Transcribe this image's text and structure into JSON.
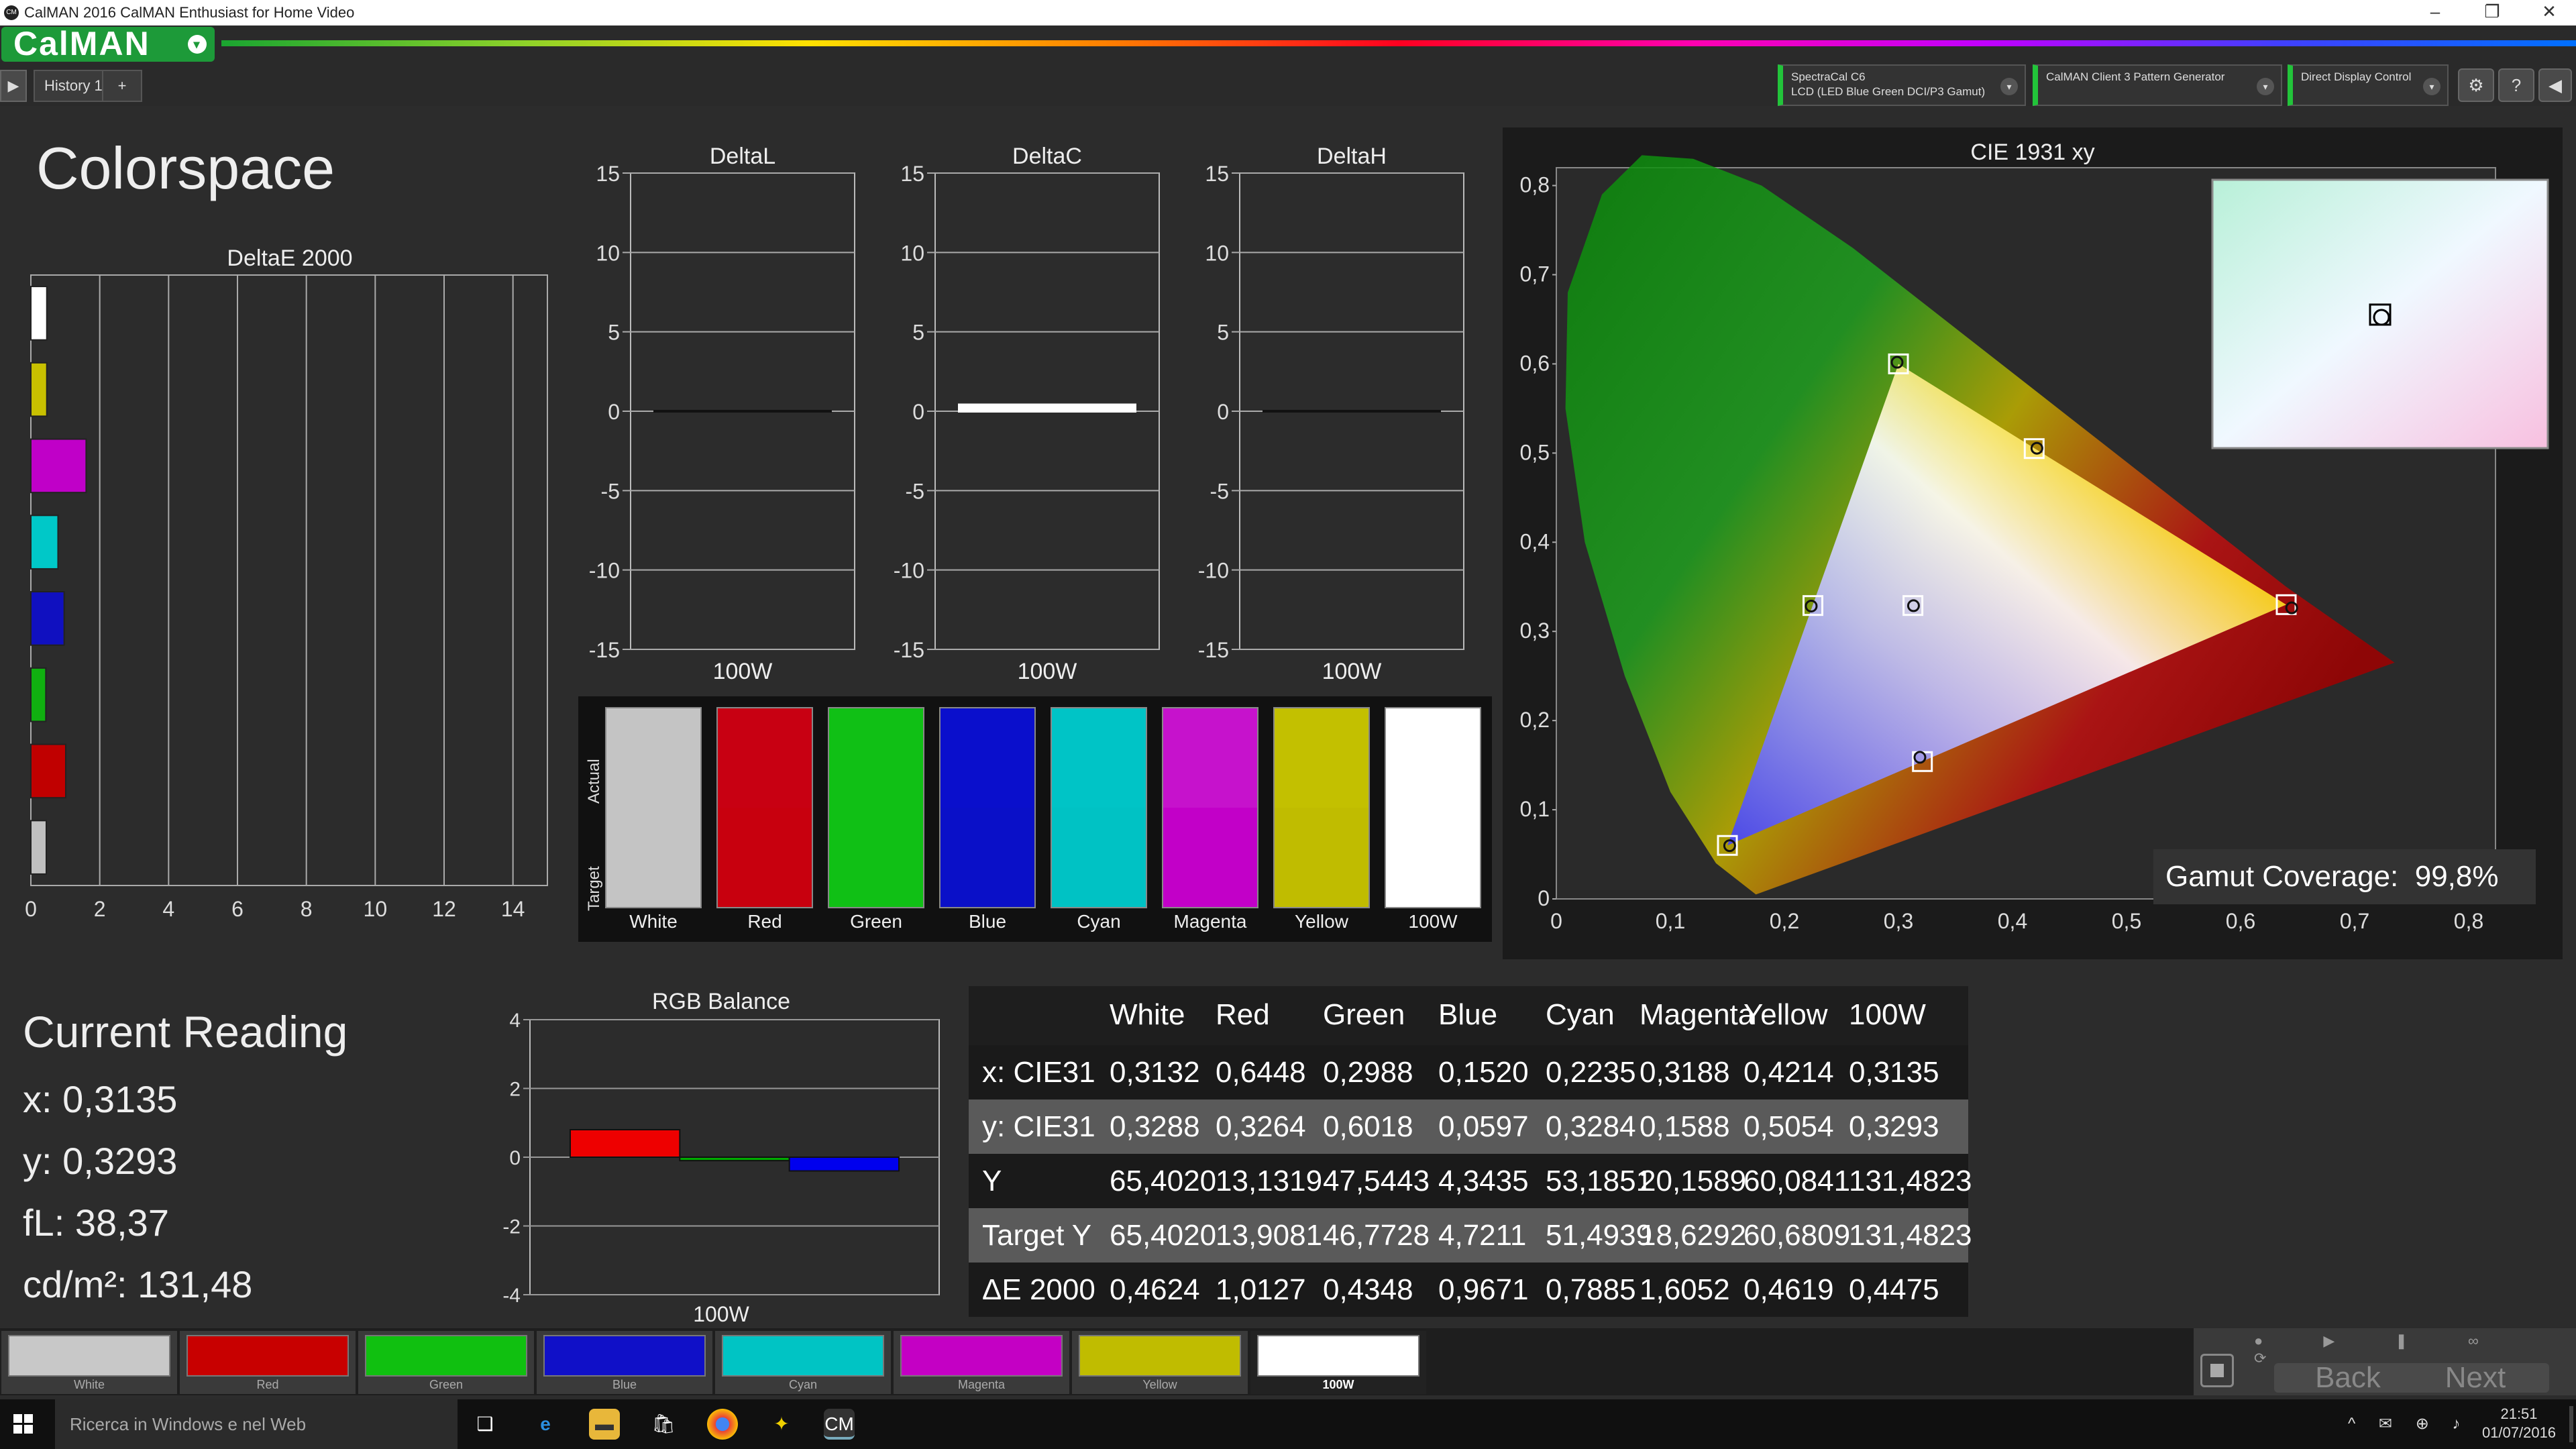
{
  "window": {
    "title": "CalMAN 2016 CalMAN Enthusiast for Home Video",
    "icon_text": "CM"
  },
  "logo": "CalMAN",
  "tabs": [
    {
      "label": "History 1"
    },
    {
      "label": "+"
    }
  ],
  "devices": [
    {
      "line1": "SpectraCal C6",
      "line2": "LCD (LED Blue Green DCI/P3 Gamut)"
    },
    {
      "line1": "CalMAN Client 3 Pattern Generator",
      "line2": ""
    },
    {
      "line1": "Direct Display Control",
      "line2": ""
    }
  ],
  "page_title": "Colorspace",
  "deltae_chart": {
    "type": "bar",
    "title": "DeltaE 2000",
    "categories": [
      "White",
      "Yellow",
      "Magenta",
      "Cyan",
      "Blue",
      "Green",
      "Red",
      "100W"
    ],
    "values": [
      0.4624,
      0.4619,
      1.6052,
      0.7885,
      0.9671,
      0.4348,
      1.0127,
      0.4475
    ],
    "colors": [
      "#ffffff",
      "#c8c000",
      "#c000c8",
      "#00c8c8",
      "#1010c0",
      "#10b010",
      "#c00000",
      "#c0c0c0"
    ],
    "xlim": [
      0,
      15
    ],
    "ticks": [
      "0",
      "2",
      "4",
      "6",
      "8",
      "10",
      "12",
      "14"
    ]
  },
  "delta_charts": [
    {
      "title": "DeltaL",
      "xlabel": "100W",
      "value": 0.0,
      "bar_color": "#111111"
    },
    {
      "title": "DeltaC",
      "xlabel": "100W",
      "value": 0.4,
      "bar_color": "#ffffff"
    },
    {
      "title": "DeltaH",
      "xlabel": "100W",
      "value": 0.0,
      "bar_color": "#111111"
    }
  ],
  "delta_ylim": [
    -15,
    15
  ],
  "delta_ticks": [
    "15",
    "10",
    "5",
    "0",
    "-5",
    "-10",
    "-15"
  ],
  "swatch_compare": {
    "row_labels": [
      "Actual",
      "Target"
    ],
    "items": [
      {
        "label": "White",
        "actual": "#c4c4c4",
        "target": "#c4c4c4"
      },
      {
        "label": "Red",
        "actual": "#c80012",
        "target": "#c8000e"
      },
      {
        "label": "Green",
        "actual": "#10c015",
        "target": "#10c015"
      },
      {
        "label": "Blue",
        "actual": "#0a0fcc",
        "target": "#0a10c8"
      },
      {
        "label": "Cyan",
        "actual": "#00c4c6",
        "target": "#00c2c4"
      },
      {
        "label": "Magenta",
        "actual": "#c612cc",
        "target": "#c200c8"
      },
      {
        "label": "Yellow",
        "actual": "#c3c000",
        "target": "#c0bc00"
      },
      {
        "label": "100W",
        "actual": "#ffffff",
        "target": "#ffffff"
      }
    ]
  },
  "cie": {
    "title": "CIE 1931 xy",
    "xticks": [
      "0",
      "0,1",
      "0,2",
      "0,3",
      "0,4",
      "0,5",
      "0,6",
      "0,7",
      "0,8"
    ],
    "yticks": [
      "0,8",
      "0,7",
      "0,6",
      "0,5",
      "0,4",
      "0,3",
      "0,2",
      "0,1",
      "0"
    ],
    "gamut_label": "Gamut Coverage:",
    "gamut_value": "99,8%",
    "target_points": [
      {
        "name": "red",
        "x": 0.64,
        "y": 0.33
      },
      {
        "name": "green",
        "x": 0.3,
        "y": 0.6
      },
      {
        "name": "blue",
        "x": 0.15,
        "y": 0.06
      },
      {
        "name": "cyan",
        "x": 0.225,
        "y": 0.329
      },
      {
        "name": "magenta",
        "x": 0.321,
        "y": 0.154
      },
      {
        "name": "yellow",
        "x": 0.419,
        "y": 0.505
      },
      {
        "name": "white",
        "x": 0.3127,
        "y": 0.329
      }
    ],
    "measured_points": [
      {
        "name": "red",
        "x": 0.6448,
        "y": 0.3264
      },
      {
        "name": "green",
        "x": 0.2988,
        "y": 0.6018
      },
      {
        "name": "blue",
        "x": 0.152,
        "y": 0.0597
      },
      {
        "name": "cyan",
        "x": 0.2235,
        "y": 0.3284
      },
      {
        "name": "magenta",
        "x": 0.3188,
        "y": 0.1588
      },
      {
        "name": "yellow",
        "x": 0.4214,
        "y": 0.5054
      },
      {
        "name": "white",
        "x": 0.3132,
        "y": 0.3288
      }
    ]
  },
  "current_reading": {
    "title": "Current Reading",
    "lines": [
      "x: 0,3135",
      "y: 0,3293",
      "fL: 38,37",
      "cd/m²: 131,48"
    ]
  },
  "rgb_balance": {
    "type": "bar",
    "title": "RGB Balance",
    "xlabel": "100W",
    "yticks": [
      "4",
      "2",
      "0",
      "-2",
      "-4"
    ],
    "ylim": [
      -4,
      4
    ],
    "series": [
      {
        "color": "#ee0000",
        "value": 0.8
      },
      {
        "color": "#00aa00",
        "value": -0.1
      },
      {
        "color": "#0000ee",
        "value": -0.4
      }
    ]
  },
  "table": {
    "type": "table",
    "headers": [
      "",
      "White",
      "Red",
      "Green",
      "Blue",
      "Cyan",
      "Magenta",
      "Yellow",
      "100W"
    ],
    "rows": [
      [
        "x: CIE31",
        "0,3132",
        "0,6448",
        "0,2988",
        "0,1520",
        "0,2235",
        "0,3188",
        "0,4214",
        "0,3135"
      ],
      [
        "y: CIE31",
        "0,3288",
        "0,3264",
        "0,6018",
        "0,0597",
        "0,3284",
        "0,1588",
        "0,5054",
        "0,3293"
      ],
      [
        "Y",
        "65,4020",
        "13,1319",
        "47,5443",
        "4,3435",
        "53,1851",
        "20,1589",
        "60,0841",
        "131,4823"
      ],
      [
        "Target Y",
        "65,4020",
        "13,9081",
        "46,7728",
        "4,7211",
        "51,4939",
        "18,6292",
        "60,6809",
        "131,4823"
      ],
      [
        "ΔE 2000",
        "0,4624",
        "1,0127",
        "0,4348",
        "0,9671",
        "0,7885",
        "1,6052",
        "0,4619",
        "0,4475"
      ]
    ]
  },
  "bottom_swatches": [
    {
      "label": "White",
      "color": "#c8c8c8"
    },
    {
      "label": "Red",
      "color": "#c80000"
    },
    {
      "label": "Green",
      "color": "#10c010"
    },
    {
      "label": "Blue",
      "color": "#1010c8"
    },
    {
      "label": "Cyan",
      "color": "#00c4c4"
    },
    {
      "label": "Magenta",
      "color": "#c400c4"
    },
    {
      "label": "Yellow",
      "color": "#c0bc00"
    },
    {
      "label": "100W",
      "color": "#ffffff"
    }
  ],
  "nav": {
    "back": "Back",
    "next": "Next"
  },
  "taskbar": {
    "search": "Ricerca in Windows e nel Web",
    "time": "21:51",
    "date": "01/07/2016"
  }
}
